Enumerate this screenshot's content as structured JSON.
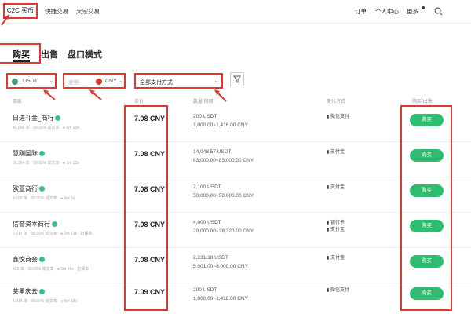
{
  "nav": {
    "c2c": "C2C 买币",
    "quick": "快捷交易",
    "block": "大宗交易",
    "orders": "订单",
    "profile": "个人中心",
    "more": "更多"
  },
  "tabs": {
    "buy": "购买",
    "sell": "出售",
    "pending": "盘口模式"
  },
  "filters": {
    "coin": "USDT",
    "fiat": "CNY",
    "fiat_prefix": "金额",
    "payment": "全部支付方式"
  },
  "table_headers": {
    "merchant": "商家",
    "price": "单价",
    "amount": "数量/限额",
    "payment": "支付方式",
    "action": "购买/出售"
  },
  "rows": [
    {
      "name": "日进斗金_商行",
      "stats": "49,006 单 · 99.95% 成交率 · ● 0m 13s",
      "price": "7.08 CNY",
      "qty": "200 USDT",
      "limit": "1,000.00~1,416.00 CNY",
      "pay1": "▮ 微信支付",
      "pay2": "",
      "btn": "购买"
    },
    {
      "name": "慧刚国际",
      "stats": "26,364 单 · 99.93% 成交率 · ● 1m 13s",
      "price": "7.08 CNY",
      "qty": "14,048.57 USDT",
      "limit": "83,000.00~83,000.00 CNY",
      "pay1": "▮ 支付宝",
      "pay2": "",
      "btn": "购买"
    },
    {
      "name": "欧亚商行",
      "stats": "4,690 单 · 99.95% 成交率 · ● 0m 7s",
      "price": "7.08 CNY",
      "qty": "7,100 USDT",
      "limit": "50,000.00~50,000.00 CNY",
      "pay1": "▮ 支付宝",
      "pay2": "",
      "btn": "购买"
    },
    {
      "name": "信誉资本商行",
      "stats": "7,217 单 · 98.93% 成交率 · ● 1m 12s · 担保单",
      "price": "7.08 CNY",
      "qty": "4,000 USDT",
      "limit": "20,000.00~28,320.00 CNY",
      "pay1": "▮ 银行卡",
      "pay2": "▮ 支付宝",
      "btn": "购买"
    },
    {
      "name": "鑫悦商会",
      "stats": "423 单 · 99.60% 成交率 · ● 0m 46s · 担保单",
      "price": "7.08 CNY",
      "qty": "2,231.18 USDT",
      "limit": "5,001.00~8,000.00 CNY",
      "pay1": "▮ 支付宝",
      "pay2": "",
      "btn": "购买"
    },
    {
      "name": "莱星庆云",
      "stats": "1,016 单 · 99.89% 成交率 · ● 0m 18s",
      "price": "7.09 CNY",
      "qty": "200 USDT",
      "limit": "1,000.00~1,418.00 CNY",
      "pay1": "▮ 微信支付",
      "pay2": "",
      "btn": "购买"
    }
  ],
  "colors": {
    "accent_red": "#e0372f",
    "buy_green": "#2ebd6f",
    "verified": "#3fbf8a"
  }
}
